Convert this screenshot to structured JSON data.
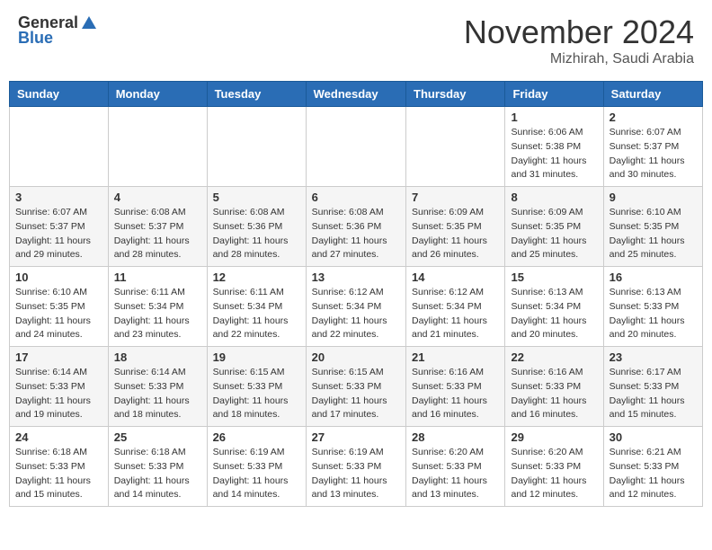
{
  "header": {
    "logo_general": "General",
    "logo_blue": "Blue",
    "month_title": "November 2024",
    "location": "Mizhirah, Saudi Arabia"
  },
  "days_of_week": [
    "Sunday",
    "Monday",
    "Tuesday",
    "Wednesday",
    "Thursday",
    "Friday",
    "Saturday"
  ],
  "weeks": [
    [
      {
        "day": "",
        "info": ""
      },
      {
        "day": "",
        "info": ""
      },
      {
        "day": "",
        "info": ""
      },
      {
        "day": "",
        "info": ""
      },
      {
        "day": "",
        "info": ""
      },
      {
        "day": "1",
        "info": "Sunrise: 6:06 AM\nSunset: 5:38 PM\nDaylight: 11 hours\nand 31 minutes."
      },
      {
        "day": "2",
        "info": "Sunrise: 6:07 AM\nSunset: 5:37 PM\nDaylight: 11 hours\nand 30 minutes."
      }
    ],
    [
      {
        "day": "3",
        "info": "Sunrise: 6:07 AM\nSunset: 5:37 PM\nDaylight: 11 hours\nand 29 minutes."
      },
      {
        "day": "4",
        "info": "Sunrise: 6:08 AM\nSunset: 5:37 PM\nDaylight: 11 hours\nand 28 minutes."
      },
      {
        "day": "5",
        "info": "Sunrise: 6:08 AM\nSunset: 5:36 PM\nDaylight: 11 hours\nand 28 minutes."
      },
      {
        "day": "6",
        "info": "Sunrise: 6:08 AM\nSunset: 5:36 PM\nDaylight: 11 hours\nand 27 minutes."
      },
      {
        "day": "7",
        "info": "Sunrise: 6:09 AM\nSunset: 5:35 PM\nDaylight: 11 hours\nand 26 minutes."
      },
      {
        "day": "8",
        "info": "Sunrise: 6:09 AM\nSunset: 5:35 PM\nDaylight: 11 hours\nand 25 minutes."
      },
      {
        "day": "9",
        "info": "Sunrise: 6:10 AM\nSunset: 5:35 PM\nDaylight: 11 hours\nand 25 minutes."
      }
    ],
    [
      {
        "day": "10",
        "info": "Sunrise: 6:10 AM\nSunset: 5:35 PM\nDaylight: 11 hours\nand 24 minutes."
      },
      {
        "day": "11",
        "info": "Sunrise: 6:11 AM\nSunset: 5:34 PM\nDaylight: 11 hours\nand 23 minutes."
      },
      {
        "day": "12",
        "info": "Sunrise: 6:11 AM\nSunset: 5:34 PM\nDaylight: 11 hours\nand 22 minutes."
      },
      {
        "day": "13",
        "info": "Sunrise: 6:12 AM\nSunset: 5:34 PM\nDaylight: 11 hours\nand 22 minutes."
      },
      {
        "day": "14",
        "info": "Sunrise: 6:12 AM\nSunset: 5:34 PM\nDaylight: 11 hours\nand 21 minutes."
      },
      {
        "day": "15",
        "info": "Sunrise: 6:13 AM\nSunset: 5:34 PM\nDaylight: 11 hours\nand 20 minutes."
      },
      {
        "day": "16",
        "info": "Sunrise: 6:13 AM\nSunset: 5:33 PM\nDaylight: 11 hours\nand 20 minutes."
      }
    ],
    [
      {
        "day": "17",
        "info": "Sunrise: 6:14 AM\nSunset: 5:33 PM\nDaylight: 11 hours\nand 19 minutes."
      },
      {
        "day": "18",
        "info": "Sunrise: 6:14 AM\nSunset: 5:33 PM\nDaylight: 11 hours\nand 18 minutes."
      },
      {
        "day": "19",
        "info": "Sunrise: 6:15 AM\nSunset: 5:33 PM\nDaylight: 11 hours\nand 18 minutes."
      },
      {
        "day": "20",
        "info": "Sunrise: 6:15 AM\nSunset: 5:33 PM\nDaylight: 11 hours\nand 17 minutes."
      },
      {
        "day": "21",
        "info": "Sunrise: 6:16 AM\nSunset: 5:33 PM\nDaylight: 11 hours\nand 16 minutes."
      },
      {
        "day": "22",
        "info": "Sunrise: 6:16 AM\nSunset: 5:33 PM\nDaylight: 11 hours\nand 16 minutes."
      },
      {
        "day": "23",
        "info": "Sunrise: 6:17 AM\nSunset: 5:33 PM\nDaylight: 11 hours\nand 15 minutes."
      }
    ],
    [
      {
        "day": "24",
        "info": "Sunrise: 6:18 AM\nSunset: 5:33 PM\nDaylight: 11 hours\nand 15 minutes."
      },
      {
        "day": "25",
        "info": "Sunrise: 6:18 AM\nSunset: 5:33 PM\nDaylight: 11 hours\nand 14 minutes."
      },
      {
        "day": "26",
        "info": "Sunrise: 6:19 AM\nSunset: 5:33 PM\nDaylight: 11 hours\nand 14 minutes."
      },
      {
        "day": "27",
        "info": "Sunrise: 6:19 AM\nSunset: 5:33 PM\nDaylight: 11 hours\nand 13 minutes."
      },
      {
        "day": "28",
        "info": "Sunrise: 6:20 AM\nSunset: 5:33 PM\nDaylight: 11 hours\nand 13 minutes."
      },
      {
        "day": "29",
        "info": "Sunrise: 6:20 AM\nSunset: 5:33 PM\nDaylight: 11 hours\nand 12 minutes."
      },
      {
        "day": "30",
        "info": "Sunrise: 6:21 AM\nSunset: 5:33 PM\nDaylight: 11 hours\nand 12 minutes."
      }
    ]
  ]
}
